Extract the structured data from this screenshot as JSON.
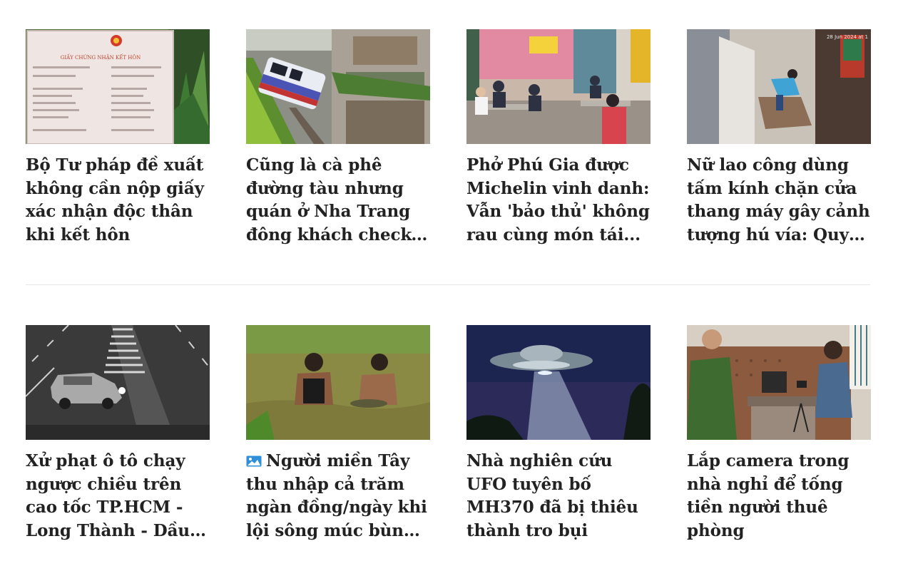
{
  "rows": [
    {
      "articles": [
        {
          "title": "Bộ Tư pháp đề xuất không cần nộp giấy xác nhận độc thân khi kết hôn",
          "thumb_text": "GIẤY CHỨNG NHẬN KẾT HÔN"
        },
        {
          "title": "Cũng là cà phê đường tàu nhưng quán ở Nha Trang đông khách check-in vì không..."
        },
        {
          "title": "Phở Phú Gia được Michelin vinh danh: Vẫn 'bảo thủ' không rau cùng món tái..."
        },
        {
          "title": "Nữ lao công dùng tấm kính chặn cửa thang máy gây cảnh tượng hú vía: Quy tắc an...",
          "thumb_text": "28 Jun 2024 at 1"
        }
      ]
    },
    {
      "articles": [
        {
          "title": "Xử phạt ô tô chạy ngược chiều trên cao tốc TP.HCM - Long Thành - Dầu Giây"
        },
        {
          "title": "Người miền Tây thu nhập cả trăm ngàn đồng/ngày khi lội sông múc bùn non",
          "icon": "photo-gallery-icon"
        },
        {
          "title": "Nhà nghiên cứu UFO tuyên bố MH370 đã bị thiêu thành tro bụi"
        },
        {
          "title": "Lắp camera trong nhà nghỉ để tống tiền người thuê phòng"
        }
      ]
    }
  ],
  "colors": {
    "headline": "#222222",
    "divider": "#e6e6e6",
    "icon_blue": "#2f8fd8"
  }
}
